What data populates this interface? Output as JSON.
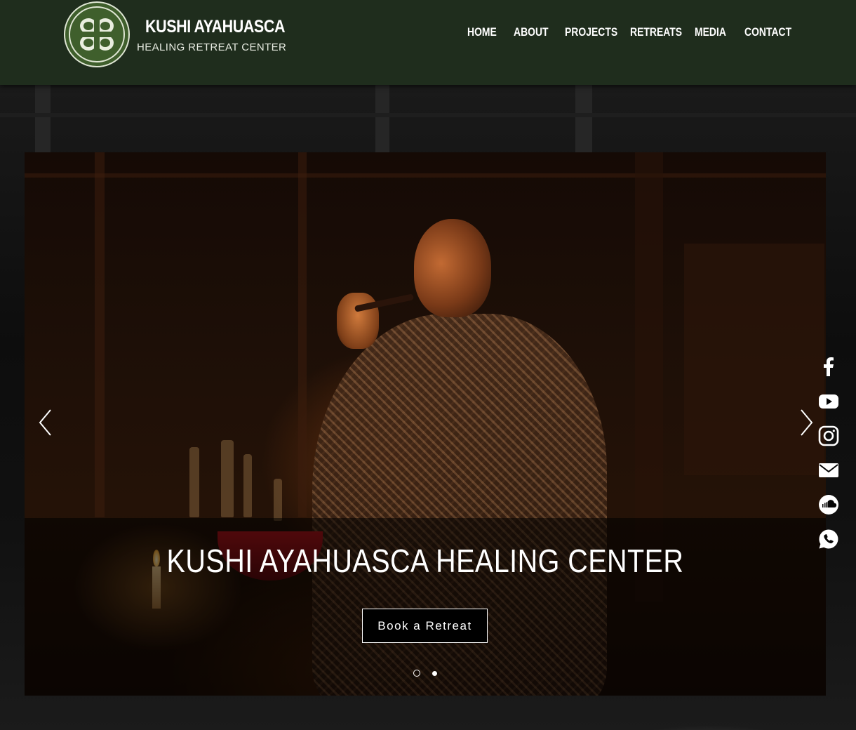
{
  "brand": {
    "title": "KUSHI AYAHUASCA",
    "subtitle": "HEALING RETREAT CENTER",
    "logo_icon": "four-leaf-logo-icon"
  },
  "nav": {
    "items": [
      {
        "label": "HOME"
      },
      {
        "label": "ABOUT"
      },
      {
        "label": "PROJECTS"
      },
      {
        "label": "RETREATS"
      },
      {
        "label": "MEDIA"
      },
      {
        "label": "CONTACT"
      }
    ]
  },
  "hero": {
    "title": "KUSHI AYAHUASCA HEALING CENTER",
    "cta_label": "Book a Retreat",
    "slide_count": 2,
    "active_slide": 1,
    "prev_icon": "chevron-left-icon",
    "next_icon": "chevron-right-icon"
  },
  "social": {
    "icons": [
      "facebook-icon",
      "youtube-icon",
      "instagram-icon",
      "mail-icon",
      "soundcloud-icon",
      "whatsapp-icon"
    ]
  },
  "colors": {
    "header_bg": "#1f2d1d",
    "logo_green": "#3f5f2c",
    "text": "#ffffff"
  }
}
